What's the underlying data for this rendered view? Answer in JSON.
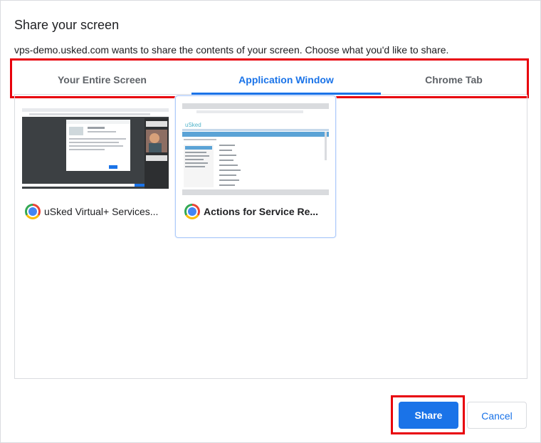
{
  "dialog": {
    "title": "Share your screen",
    "description": "vps-demo.usked.com wants to share the contents of your screen. Choose what you'd like to share."
  },
  "tabs": [
    {
      "label": "Your Entire Screen",
      "active": false
    },
    {
      "label": "Application Window",
      "active": true
    },
    {
      "label": "Chrome Tab",
      "active": false
    }
  ],
  "windows": [
    {
      "title": "uSked Virtual+ Services...",
      "icon": "chrome-icon",
      "selected": false
    },
    {
      "title": "Actions for Service Re...",
      "icon": "chrome-icon",
      "selected": true
    }
  ],
  "thumbnail_text": {
    "logo": "uSked"
  },
  "buttons": {
    "share": "Share",
    "cancel": "Cancel"
  },
  "colors": {
    "accent": "#1a73e8",
    "annotation": "#e8000b"
  }
}
